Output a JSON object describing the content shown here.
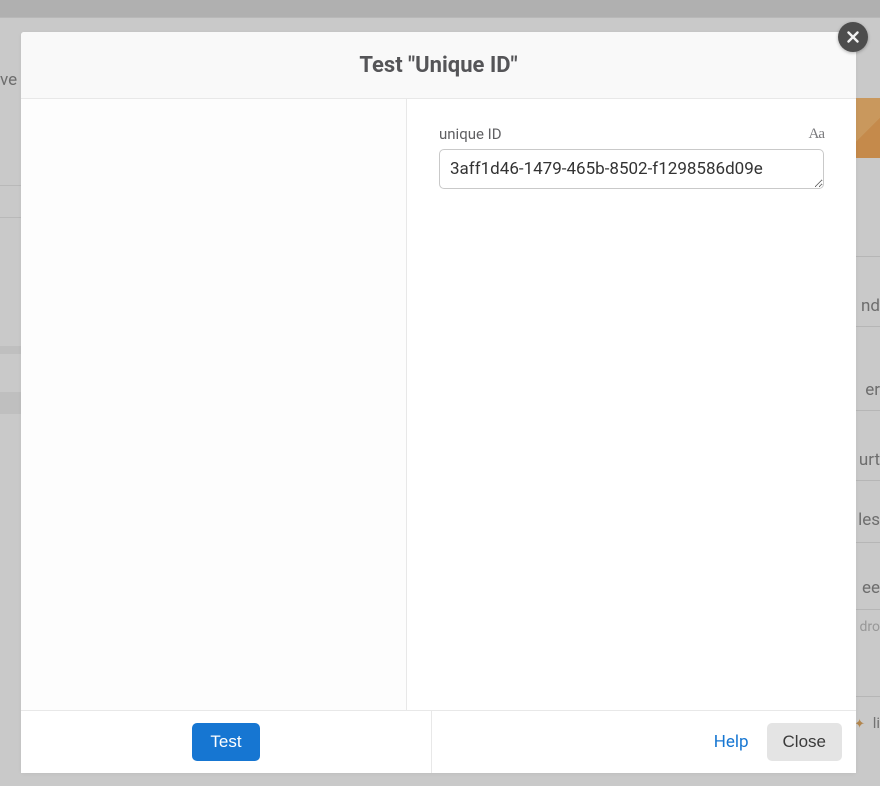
{
  "modal": {
    "title": "Test \"Unique ID\"",
    "left_pane": {},
    "right_pane": {
      "field_label": "unique ID",
      "field_value": "3aff1d46-1479-465b-8502-f1298586d09e",
      "aa_toggle": "Aa"
    },
    "footer": {
      "test_label": "Test",
      "help_label": "Help",
      "close_label": "Close"
    }
  },
  "background": {
    "left_text_fragment": "ve",
    "row_fragments": [
      "nd",
      "er",
      "urt",
      "les",
      "ee"
    ],
    "hint_fragment": "r dro",
    "footer_fragment": "li",
    "icon_glyph": "✦"
  }
}
